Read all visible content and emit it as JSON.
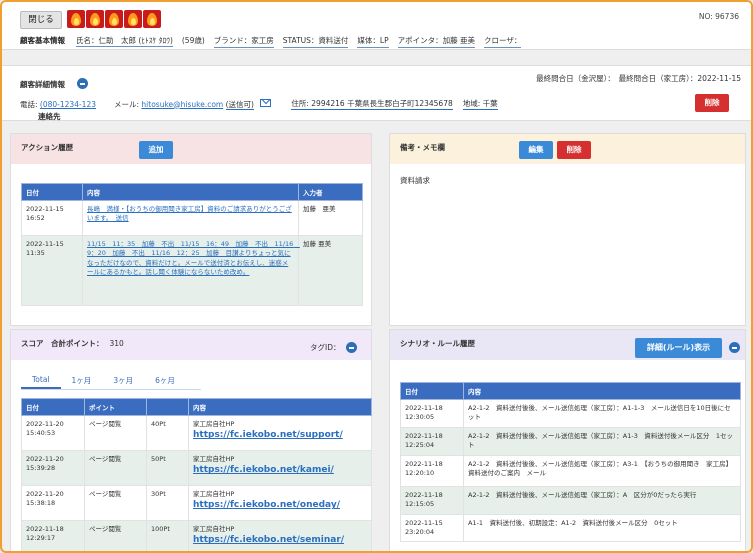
{
  "header": {
    "close_label": "閉じる",
    "flame_count": 5,
    "no_label": "NO: 96736",
    "section_title": "顧客基本情報",
    "name": "氏名：仁助　太郎 (ﾋﾄｽｹ ﾀﾛｳ)",
    "age": "(59歳)",
    "brand": "ブランド：家工房",
    "status": "STATUS：資料送付",
    "media": "媒体：LP",
    "appointer": "アポインタ：加藤 亜美",
    "closer": "クローザ："
  },
  "detail": {
    "title": "顧客詳細情報",
    "last_inquiry": "最終問合日（金沢屋）：　最終問合日（家工房）：2022-11-15",
    "contact_title": "連絡先",
    "phone_label": "電話:",
    "phone": "080-1234-123",
    "mail_label": "メール:",
    "mail": "hitosuke@hisuke.com",
    "mail_status": "(送信可)",
    "address": "住所: 2994216 千葉県長生郡白子町12345678",
    "area": "地域: 千葉",
    "delete_label": "削除"
  },
  "action": {
    "title": "アクション履歴",
    "add_label": "追加",
    "columns": [
      "日付",
      "内容",
      "入力者"
    ],
    "rows": [
      {
        "date": "2022-11-15 16:52",
        "content": "長嶋　満様・【おうちの御用聞き家工房】資料のご請求ありがとうございます。　送信",
        "author": "加藤　亜美"
      },
      {
        "date": "2022-11-15 11:35",
        "content": "11/15　11：35　加藤　不出　11/15　16：49　加藤　不出　11/16　9：20　加藤　不出　11/16　12：25　加藤　目讃よりちょっと気になっただけなので、資料だけと。メールで送付済とお伝えし、迷惑メールにあるかもと。話し聞く体験にならないため改め。",
        "author": "加藤 亜美"
      }
    ]
  },
  "memo": {
    "title": "備考・メモ欄",
    "edit_label": "編集",
    "delete_label": "削除",
    "body": "資料請求"
  },
  "score": {
    "title": "スコア　合計ポイント：",
    "total": "310",
    "tag_label": "タグID：",
    "tabs": [
      "Total",
      "1ヶ月",
      "3ヶ月",
      "6ヶ月"
    ],
    "columns": [
      "日付",
      "ポイント",
      "",
      "内容"
    ],
    "rows": [
      {
        "date": "2022-11-20 15:40:53",
        "type": "ページ閲覧",
        "points": "40Pt",
        "prefix": "家工房自社HP",
        "url": "https://fc.iekobo.net/support/"
      },
      {
        "date": "2022-11-20 15:39:28",
        "type": "ページ閲覧",
        "points": "50Pt",
        "prefix": "家工房自社HP",
        "url": "https://fc.iekobo.net/kamei/"
      },
      {
        "date": "2022-11-20 15:38:18",
        "type": "ページ閲覧",
        "points": "30Pt",
        "prefix": "家工房自社HP",
        "url": "https://fc.iekobo.net/oneday/"
      },
      {
        "date": "2022-11-18 12:29:17",
        "type": "ページ閲覧",
        "points": "100Pt",
        "prefix": "家工房自社HP",
        "url": "https://fc.iekobo.net/seminar/"
      }
    ]
  },
  "scenario": {
    "title": "シナリオ・ルール履歴",
    "detail_label": "詳細(ルール)表示",
    "columns": [
      "日付",
      "内容"
    ],
    "rows": [
      {
        "date": "2022-11-18 12:30:05",
        "content": "A2-1-2　資料送付後後、メール送信処理（家工房）：A1-1-3　メール送信日を10日後にセット"
      },
      {
        "date": "2022-11-18 12:25:04",
        "content": "A2-1-2　資料送付後後、メール送信処理（家工房）：A1-3　資料送付後メール区分　1セット"
      },
      {
        "date": "2022-11-18 12:20:10",
        "content": "A2-1-2　資料送付後後、メール送信処理（家工房）：A3-1　【おうちの御用聞き　家工房】資料送付のご案内　メール"
      },
      {
        "date": "2022-11-18 12:15:05",
        "content": "A2-1-2　資料送付後後、メール送信処理（家工房）：A　区分が0だったら実行"
      },
      {
        "date": "2022-11-15 23:20:04",
        "content": "A1-1　資料送付後、初期設定：A1-2　資料送付後メール区分　0セット"
      }
    ]
  },
  "colors": {
    "accent": "#3b8ad8",
    "danger": "#d62f2f",
    "table_header": "#3a6cc0",
    "frame": "#f0a030"
  }
}
